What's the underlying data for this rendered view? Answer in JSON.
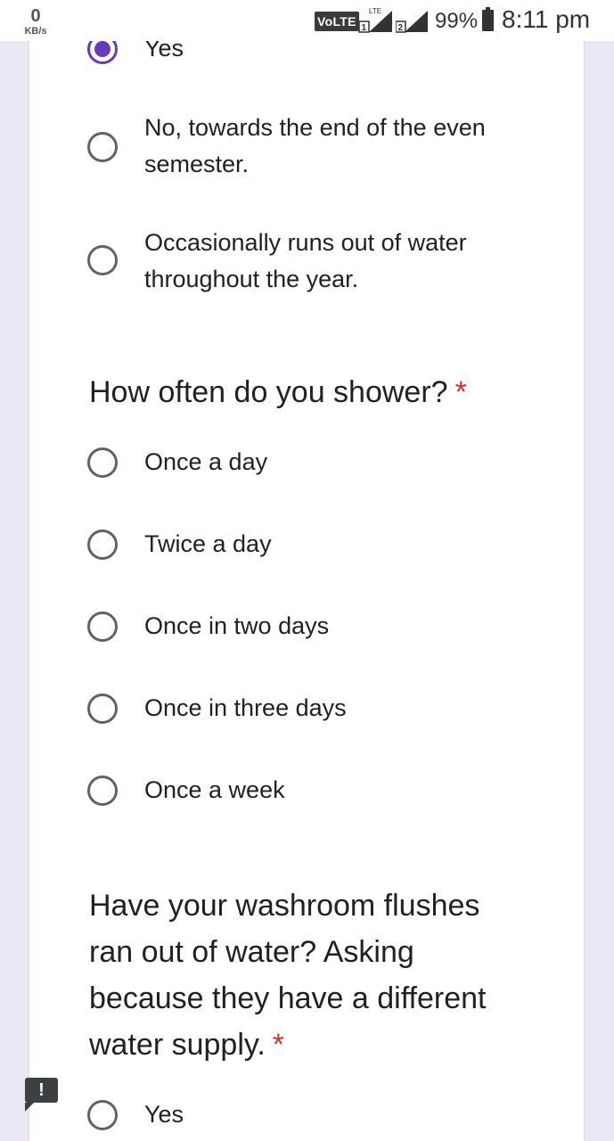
{
  "status_bar": {
    "speed_value": "0",
    "speed_unit": "KB/s",
    "volte": "VoLTE",
    "lte": "LTE",
    "sim1": "1",
    "sim2": "2",
    "battery": "99%",
    "time": "8:11 pm"
  },
  "q_prev": {
    "options": [
      {
        "label": "Yes",
        "selected": true
      },
      {
        "label": "No, towards the end of the even semester.",
        "selected": false
      },
      {
        "label": "Occasionally runs out of water throughout the year.",
        "selected": false
      }
    ]
  },
  "q_shower": {
    "title": "How often do you shower?",
    "required_mark": "*",
    "options": [
      {
        "label": "Once a day"
      },
      {
        "label": "Twice a day"
      },
      {
        "label": "Once in two days"
      },
      {
        "label": "Once in three days"
      },
      {
        "label": "Once a week"
      }
    ]
  },
  "q_flush": {
    "title": "Have your washroom flushes ran out of water? Asking because they have a different water supply.",
    "required_mark": "*",
    "options": [
      {
        "label": "Yes"
      }
    ]
  },
  "feedback": {
    "label": "!"
  },
  "colors": {
    "accent": "#673ab7",
    "required": "#d93025",
    "background": "#ebe7f5",
    "radio_border": "#5f6368"
  }
}
